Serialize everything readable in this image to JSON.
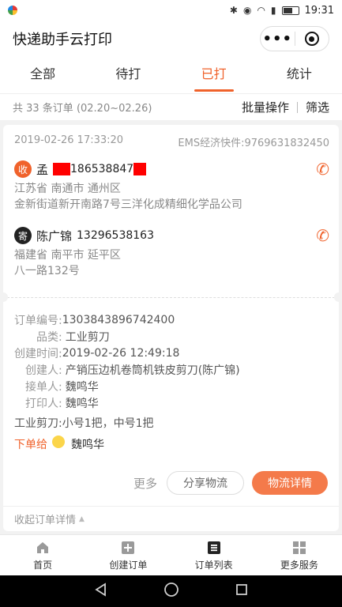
{
  "status_bar": {
    "time": "19:31"
  },
  "app": {
    "title": "快递助手云打印"
  },
  "tabs": [
    {
      "label": "全部"
    },
    {
      "label": "待打"
    },
    {
      "label": "已打"
    },
    {
      "label": "统计"
    }
  ],
  "summary": {
    "count_text": "共 33 条订单 (02.20~02.26)",
    "batch_label": "批量操作",
    "filter_label": "筛选"
  },
  "order": {
    "datetime": "2019-02-26 17:33:20",
    "waybill": "EMS经济快件:9769631832450",
    "receiver": {
      "badge": "收",
      "name": "孟",
      "phone": "186538847",
      "address_line1": "江苏省 南通市 通州区",
      "address_line2": "金新街道新开南路7号三洋化成精细化学品公司"
    },
    "sender": {
      "badge": "寄",
      "name": "陈广锦",
      "phone": "13296538163",
      "address_line1": "福建省 南平市 延平区",
      "address_line2": "八一路132号"
    },
    "details": {
      "order_no_label": "订单编号:",
      "order_no": "1303843896742400",
      "category_label": "品类:",
      "category": "工业剪刀",
      "created_label": "创建时间:",
      "created": "2019-02-26 12:49:18",
      "creator_label": "创建人:",
      "creator": "产销压边机卷筒机铁皮剪刀(陈广锦)",
      "receiver_label": "接单人:",
      "receiver": "魏鸣华",
      "printer_label": "打印人:",
      "printer": "魏鸣华",
      "goods": "工业剪刀:小号1把，中号1把"
    },
    "assign_label": "下单给",
    "assign_to": "魏鸣华",
    "more_label": "更多",
    "share_label": "分享物流",
    "detail_label": "物流详情",
    "collapse_label": "收起订单详情"
  },
  "bottom_nav": [
    {
      "label": "首页",
      "icon": "home-icon"
    },
    {
      "label": "创建订单",
      "icon": "plus-square-icon"
    },
    {
      "label": "订单列表",
      "icon": "list-icon"
    },
    {
      "label": "更多服务",
      "icon": "grid-icon"
    }
  ],
  "colors": {
    "accent": "#f0622b"
  }
}
